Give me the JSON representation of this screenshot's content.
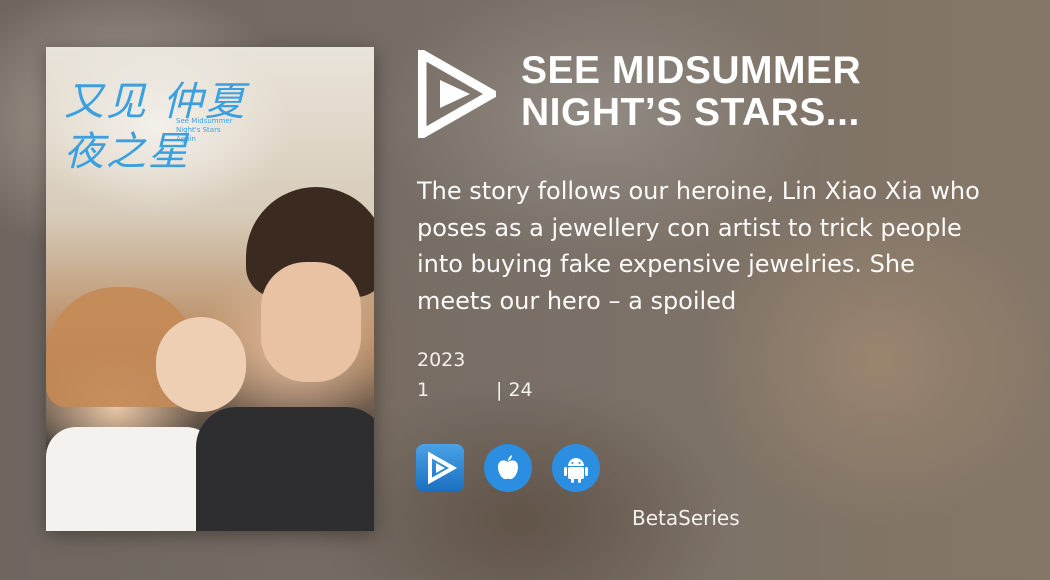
{
  "show": {
    "title_line1": "SEE MIDSUMMER",
    "title_line2": "NIGHT’S STARS...",
    "description": "The story follows our heroine, Lin Xiao Xia who poses as a jewellery con artist to trick people into buying fake expensive jewelries. She meets our hero – a spoiled",
    "year": "2023",
    "seasons": "1",
    "episodes": "| 24"
  },
  "poster": {
    "calligraphy": "又见 仲夏夜之星",
    "calligraphy_sub": "See Midsummer Night's Stars Again"
  },
  "stores": [
    {
      "name": "betaseries-app",
      "icon": "betaseries-play-icon"
    },
    {
      "name": "apple",
      "icon": "apple-icon"
    },
    {
      "name": "android",
      "icon": "android-icon"
    }
  ],
  "brand": "BetaSeries",
  "colors": {
    "accent": "#2b8ee0",
    "logo": "#ffffff",
    "calligraphy": "#3aa0e0"
  }
}
